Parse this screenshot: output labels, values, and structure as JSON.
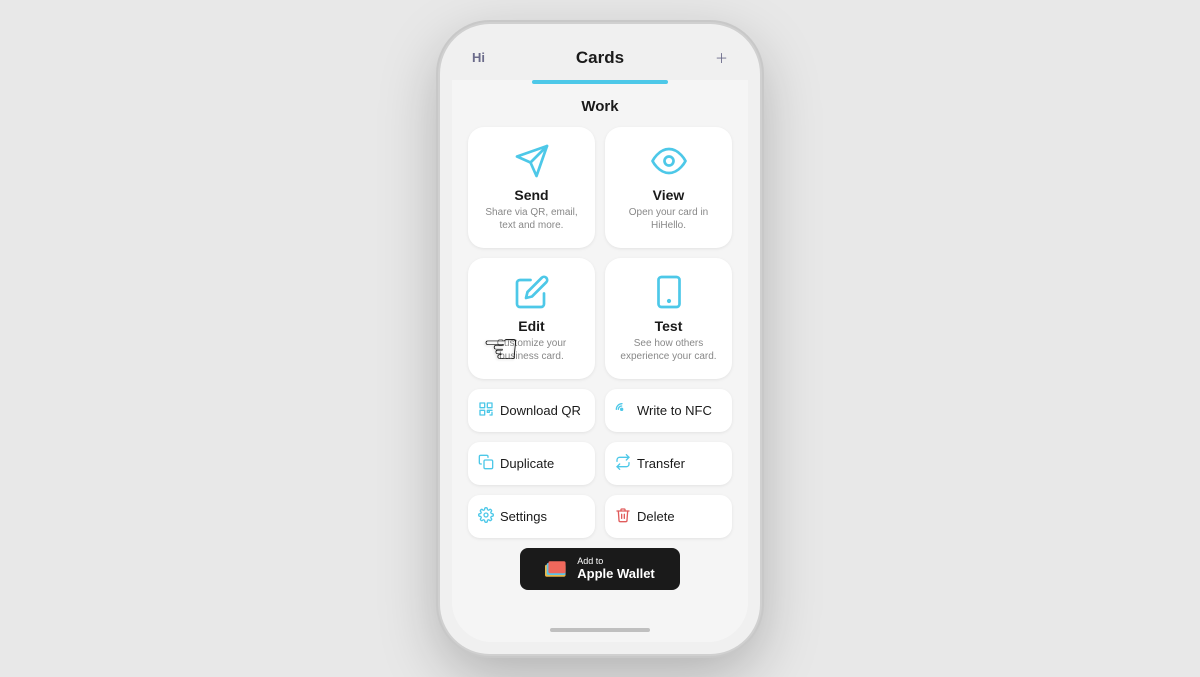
{
  "header": {
    "left_label": "Hi",
    "title": "Cards",
    "right_icon": "plus-icon"
  },
  "section": {
    "title": "Work"
  },
  "action_cards": [
    {
      "id": "send",
      "title": "Send",
      "subtitle": "Share via QR, email, text and more.",
      "icon": "send-icon"
    },
    {
      "id": "view",
      "title": "View",
      "subtitle": "Open your card in HiHello.",
      "icon": "view-icon"
    },
    {
      "id": "edit",
      "title": "Edit",
      "subtitle": "Customize your business card.",
      "icon": "edit-icon"
    },
    {
      "id": "test",
      "title": "Test",
      "subtitle": "See how others experience your card.",
      "icon": "test-icon"
    }
  ],
  "action_buttons": [
    {
      "id": "download-qr",
      "label": "Download QR",
      "icon": "qr-icon",
      "type": "normal"
    },
    {
      "id": "write-nfc",
      "label": "Write to NFC",
      "icon": "nfc-icon",
      "type": "normal"
    },
    {
      "id": "duplicate",
      "label": "Duplicate",
      "icon": "duplicate-icon",
      "type": "normal"
    },
    {
      "id": "transfer",
      "label": "Transfer",
      "icon": "transfer-icon",
      "type": "normal"
    },
    {
      "id": "settings",
      "label": "Settings",
      "icon": "settings-icon",
      "type": "normal"
    },
    {
      "id": "delete",
      "label": "Delete",
      "icon": "delete-icon",
      "type": "danger"
    }
  ],
  "wallet": {
    "add_label": "Add to",
    "name_label": "Apple Wallet"
  },
  "colors": {
    "accent": "#4dc8e8",
    "danger": "#e05c5c",
    "text_primary": "#1a1a1a",
    "text_secondary": "#888888",
    "card_bg": "#ffffff",
    "screen_bg": "#f5f5f5",
    "header_text_left": "#6b6b8a"
  }
}
